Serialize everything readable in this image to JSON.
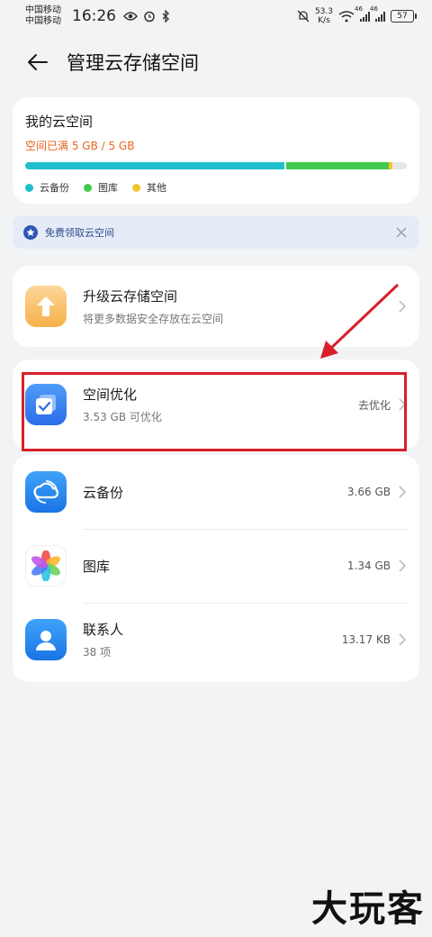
{
  "status_bar": {
    "carrier1": "中国移动",
    "carrier2": "中国移动",
    "time": "16:26",
    "net_speed_value": "53.3",
    "net_speed_unit": "K/s",
    "signal_label": "46",
    "battery": "57"
  },
  "header": {
    "title": "管理云存储空间"
  },
  "storage": {
    "title": "我的云空间",
    "status": "空间已满 5 GB / 5 GB",
    "bar": {
      "backup_fraction": 0.68,
      "gallery_fraction": 0.27,
      "other_fraction": 0.01,
      "colors": {
        "backup": "#1fbfcc",
        "gallery": "#43c94e",
        "other": "#f5c330"
      }
    },
    "legend": [
      {
        "label": "云备份",
        "color": "#1fbfcc"
      },
      {
        "label": "图库",
        "color": "#43c94e"
      },
      {
        "label": "其他",
        "color": "#f5c330"
      }
    ]
  },
  "promo": {
    "text": "免费领取云空间"
  },
  "upgrade": {
    "title": "升级云存储空间",
    "subtitle": "将更多数据安全存放在云空间"
  },
  "optimize": {
    "title": "空间优化",
    "subtitle": "3.53 GB 可优化",
    "action": "去优化"
  },
  "items": [
    {
      "name": "云备份",
      "value": "3.66 GB",
      "icon": "cloud-backup-icon"
    },
    {
      "name": "图库",
      "value": "1.34 GB",
      "icon": "gallery-icon"
    },
    {
      "name": "联系人",
      "subtitle": "38 项",
      "value": "13.17 KB",
      "icon": "contacts-icon"
    }
  ],
  "watermark": "大玩客"
}
